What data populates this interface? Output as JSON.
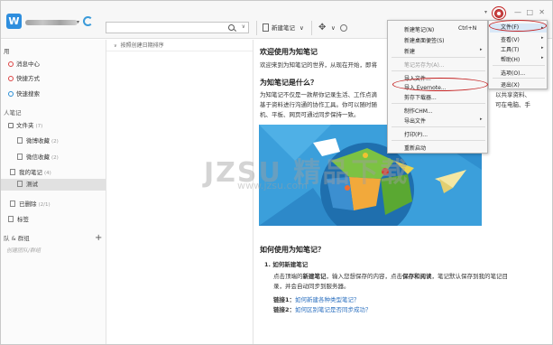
{
  "app": {
    "logo_letter": "W"
  },
  "toolbar": {
    "new_note_label": "新建笔记",
    "dropdown_caret": "∨",
    "move_glyph": "✥"
  },
  "search": {
    "placeholder": "",
    "caret": "∨"
  },
  "window": {
    "skin_glyph": "▾",
    "minimize": "—",
    "maximize": "□",
    "close": "✕"
  },
  "sidebar": {
    "section_public": "用",
    "items_public": [
      {
        "label": "消息中心",
        "icon": "bell-icon"
      },
      {
        "label": "快捷方式",
        "icon": "star-icon"
      },
      {
        "label": "快速搜索",
        "icon": "search-icon"
      }
    ],
    "section_personal": "人笔记",
    "folder_root": {
      "label": "文件夹",
      "count": "(7)"
    },
    "folders": [
      {
        "label": "微博收藏",
        "count": "(2)"
      },
      {
        "label": "微信收藏",
        "count": "(2)"
      }
    ],
    "my_notes": {
      "label": "我的笔记",
      "count": "(4)"
    },
    "selected_folder": {
      "label": "测试"
    },
    "deleted": {
      "label": "已删除",
      "count": "(2/1)"
    },
    "tags": {
      "label": "标签"
    },
    "section_groups": "队 & 群组",
    "add_label": "+",
    "create_group_hint": "创建团队/群组"
  },
  "notelist": {
    "sort_label": "按照创建日期排序"
  },
  "note": {
    "title": "欢迎使用为知笔记",
    "intro": "欢迎来到为知笔记的世界，从现在开始，即将",
    "h_what": "为知笔记是什么？",
    "what_l1": "为知笔记不仅是一款帮你记录生活、工作点滴",
    "what_l1_tail": "以共享资料、",
    "what_l2": "基于资料进行沟通的协作工具。你可以随时随",
    "what_l2_tail": "可在电脑、手",
    "what_l3": "机、平板、网页可通过同步保持一致。",
    "h_how": "如何使用为知笔记？",
    "step1": "1.  如何新建笔记",
    "how_p1_a": "点击顶端的",
    "how_p1_b": "新建笔记",
    "how_p1_c": "，输入您想保存的内容，点击",
    "how_p1_d": "保存和阅读",
    "how_p1_e": "，笔记默认保存到我的笔记目",
    "how_p2": "录，并会自动同步到服务器。",
    "link1_prefix": "链接1：",
    "link1_text": "如何新建各种类型笔记？",
    "link2_prefix": "链接2：",
    "link2_text": "如何区别笔记是否同步成功？"
  },
  "file_menu": {
    "items": [
      {
        "label": "新建笔记(N)",
        "shortcut": "Ctrl+N"
      },
      {
        "label": "新建桌面便签(S)"
      },
      {
        "label": "新建",
        "submenu": true
      },
      {
        "label": "笔记另存为(A)...",
        "disabled": true
      },
      {
        "label": "导入文件..."
      },
      {
        "label": "导入 Evernote..."
      },
      {
        "label": "剪存下载器..."
      },
      {
        "label": "制作CHM..."
      },
      {
        "label": "导出文件",
        "submenu": true
      },
      {
        "label": "打印(P)..."
      },
      {
        "label": "重新启动"
      }
    ]
  },
  "main_menu": {
    "items": [
      {
        "label": "文件(F)",
        "submenu": true
      },
      {
        "label": "查看(V)",
        "submenu": true
      },
      {
        "label": "工具(T)",
        "submenu": true
      },
      {
        "label": "帮助(H)",
        "submenu": true
      },
      {
        "label": "选项(O)..."
      },
      {
        "label": "退出(X)"
      }
    ]
  },
  "watermark": {
    "main": "JZSU 精品下载",
    "sub": "www.jzsu.com"
  },
  "colors": {
    "accent": "#2e8ede",
    "highlight_ring": "#c42222",
    "link": "#2a6fbf"
  }
}
